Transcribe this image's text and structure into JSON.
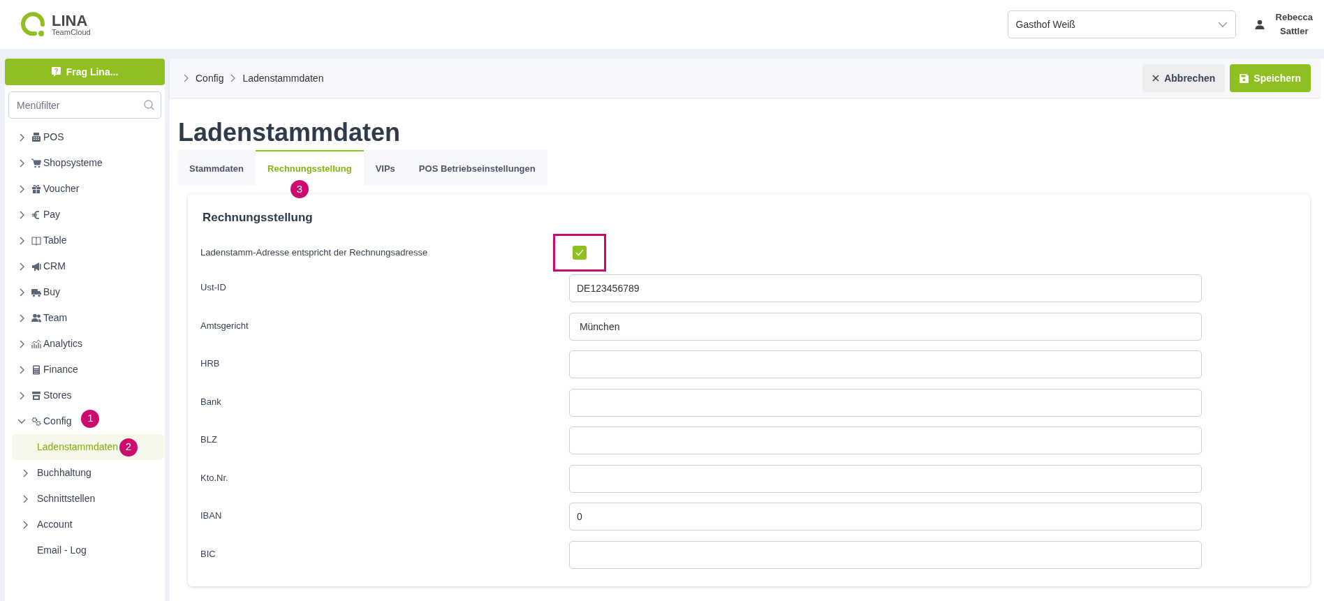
{
  "header": {
    "logo": {
      "name": "LINA",
      "subtitle": "TeamCloud"
    },
    "store_select": {
      "value": "Gasthof Weiß"
    },
    "user": {
      "first_name": "Rebecca",
      "last_name": "Sattler"
    }
  },
  "sidebar": {
    "ask_button": "Frag Lina...",
    "filter": {
      "placeholder": "Menüfilter"
    },
    "items": [
      {
        "label": "POS",
        "kind": "group",
        "expanded": false
      },
      {
        "label": "Shopsysteme",
        "kind": "group",
        "expanded": false
      },
      {
        "label": "Voucher",
        "kind": "group",
        "expanded": false
      },
      {
        "label": "Pay",
        "kind": "group",
        "expanded": false
      },
      {
        "label": "Table",
        "kind": "group",
        "expanded": false
      },
      {
        "label": "CRM",
        "kind": "group",
        "expanded": false
      },
      {
        "label": "Buy",
        "kind": "group",
        "expanded": false
      },
      {
        "label": "Team",
        "kind": "group",
        "expanded": false
      },
      {
        "label": "Analytics",
        "kind": "group",
        "expanded": false
      },
      {
        "label": "Finance",
        "kind": "group",
        "expanded": false
      },
      {
        "label": "Stores",
        "kind": "group",
        "expanded": false
      },
      {
        "label": "Config",
        "kind": "group",
        "expanded": true,
        "badge": "1",
        "children": [
          {
            "label": "Ladenstammdaten",
            "kind": "link",
            "selected": true,
            "badge": "2"
          },
          {
            "label": "Buchhaltung",
            "kind": "group",
            "expanded": false
          },
          {
            "label": "Schnittstellen",
            "kind": "group",
            "expanded": false
          },
          {
            "label": "Account",
            "kind": "group",
            "expanded": false
          },
          {
            "label": "Email - Log",
            "kind": "link",
            "selected": false
          }
        ]
      }
    ]
  },
  "breadcrumb": [
    "Config",
    "Ladenstammdaten"
  ],
  "actions": [
    {
      "label": "Abbrechen",
      "kind": "cancel"
    },
    {
      "label": "Speichern",
      "kind": "save"
    }
  ],
  "page_title": "Ladenstammdaten",
  "tabs": [
    {
      "label": "Stammdaten",
      "selected": false
    },
    {
      "label": "Rechnungsstellung",
      "selected": true,
      "badge": "3"
    },
    {
      "label": "VIPs",
      "selected": false
    },
    {
      "label": "POS Betriebseinstellungen",
      "selected": false
    }
  ],
  "form": {
    "title": "Rechnungsstellung",
    "fields": [
      {
        "label": "Ladenstamm-Adresse entspricht der Rechnungsadresse",
        "kind": "checkbox",
        "checked": true,
        "highlighted": true
      },
      {
        "label": "Ust-ID",
        "kind": "text",
        "value": "DE123456789"
      },
      {
        "label": "Amtsgericht",
        "kind": "text",
        "value": " München"
      },
      {
        "label": "HRB",
        "kind": "text"
      },
      {
        "label": "Bank",
        "kind": "text"
      },
      {
        "label": "BLZ",
        "kind": "text"
      },
      {
        "label": "Kto.Nr.",
        "kind": "text"
      },
      {
        "label": "IBAN",
        "kind": "text",
        "value": "0"
      },
      {
        "label": "BIC",
        "kind": "text"
      }
    ]
  }
}
